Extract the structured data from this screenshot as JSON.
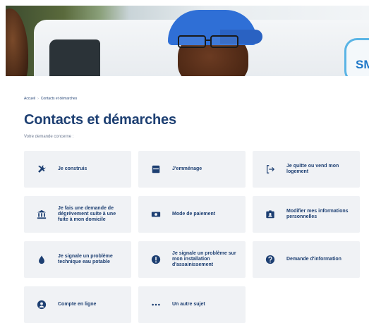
{
  "hero": {
    "logo_text": "SM"
  },
  "breadcrumb": {
    "home": "Accueil",
    "separator": "›",
    "current": "Contacts et démarches"
  },
  "page": {
    "title": "Contacts et démarches",
    "subtitle": "Votre demande concerne :"
  },
  "colors": {
    "title": "#1d3f72",
    "card_bg": "#f0f2f5",
    "icon": "#1d3f72"
  },
  "cards": [
    {
      "label": "Je construis",
      "icon": "tools-icon"
    },
    {
      "label": "J'emménage",
      "icon": "box-icon"
    },
    {
      "label": "Je quitte ou vend mon logement",
      "icon": "exit-icon"
    },
    {
      "label": "Je fais une demande de dégrèvement suite à une fuite à mon domicile",
      "icon": "bank-icon"
    },
    {
      "label": "Mode de paiement",
      "icon": "money-icon"
    },
    {
      "label": "Modifier mes informations personnelles",
      "icon": "id-card-icon"
    },
    {
      "label": "Je signale un problème technique eau potable",
      "icon": "water-drop-icon"
    },
    {
      "label": "Je signale un problème sur mon installation d'assainissement",
      "icon": "alert-icon"
    },
    {
      "label": "Demande d'information",
      "icon": "question-icon"
    },
    {
      "label": "Compte en ligne",
      "icon": "user-circle-icon"
    },
    {
      "label": "Un autre sujet",
      "icon": "more-icon"
    }
  ]
}
